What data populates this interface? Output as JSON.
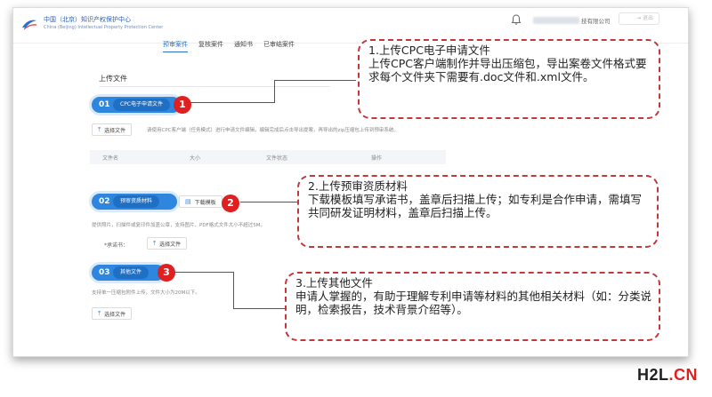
{
  "app": {
    "brand_cn": "中国（北京）知识产权保护中心",
    "brand_en": "China (Beijing) Intellectual Property Protection Center",
    "account_text": "技有限公司",
    "exit_label": "⇥ 退出"
  },
  "nav": {
    "items": [
      {
        "label": "预审案件",
        "active": true
      },
      {
        "label": "复核案件",
        "active": false
      },
      {
        "label": "通知书",
        "active": false
      },
      {
        "label": "已审结案件",
        "active": false
      }
    ]
  },
  "page": {
    "section_title": "上传文件"
  },
  "step1": {
    "num": "01",
    "label": "CPC电子申请文件",
    "badge": "1",
    "button": "选择文件",
    "helper": "请使用CPC客户端（任务模式）进行申请文件编辑，编辑完成后点击导出提案，再导出的zip压缩包上传到预审系统。",
    "table_headers": [
      "文件名",
      "大小",
      "文件状态",
      "操作"
    ]
  },
  "step2": {
    "num": "02",
    "label": "预审资质材料",
    "template_button": "下载模板",
    "badge": "2",
    "helper": "提供照片，扫描件或复印件加盖公章，支持图片、PDF格式文件大小不超过5M。",
    "field_label": "*承诺书：",
    "button": "选择文件"
  },
  "step3": {
    "num": "03",
    "label": "其他文件",
    "badge": "3",
    "helper": "支持单一压缩包附件上传，文件大小为20M以下。",
    "button": "选择文件"
  },
  "callouts": {
    "c1": {
      "heading": "1.上传CPC电子申请文件",
      "body": "上传CPC客户端制作并导出压缩包，导出案卷文件格式要求每个文件夹下需要有.doc文件和.xml文件。"
    },
    "c2": {
      "heading": "2.上传预审资质材料",
      "body": "下载模板填写承诺书，盖章后扫描上传；如专利是合作申请，需填写共同研发证明材料，盖章后扫描上传。"
    },
    "c3": {
      "heading": "3.上传其他文件",
      "body": "申请人掌握的，有助于理解专利申请等材料的其他相关材料（如：分类说明，检索报告，技术背景介绍等）。"
    }
  },
  "watermark": {
    "part1": "H2L",
    "part2": ".CN"
  },
  "colors": {
    "primary_blue": "#2e86de",
    "callout_red": "#c0393b",
    "badge_red": "#e02020"
  }
}
